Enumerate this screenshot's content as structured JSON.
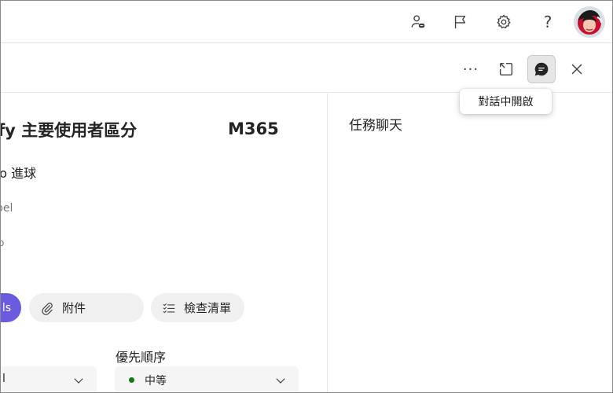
{
  "header": {
    "help_glyph": "?",
    "icons": [
      "person-chat-icon",
      "flag-icon",
      "gear-icon",
      "help-icon"
    ]
  },
  "toolbar": {
    "more_glyph": "···",
    "icons": [
      "more-options-icon",
      "expand-window-icon",
      "chat-icon",
      "close-icon"
    ]
  },
  "tooltip": {
    "text": "對話中開啟"
  },
  "task": {
    "title": "fy 主要使用者區分",
    "tag": "M365",
    "bucket": "to 進球",
    "label_fragment": "bel",
    "small_fragment": "o"
  },
  "pills": {
    "purple_label": "ls",
    "attachments_label": "附件",
    "checklist_label": "檢查清單"
  },
  "priority": {
    "label": "優先順序",
    "value": "中等",
    "left_value": "l"
  },
  "chat_panel": {
    "title": "任務聊天"
  },
  "colors": {
    "accent_purple": "#6a5be0",
    "priority_dot": "#107c10",
    "pill_bg": "#f0f0f0"
  }
}
